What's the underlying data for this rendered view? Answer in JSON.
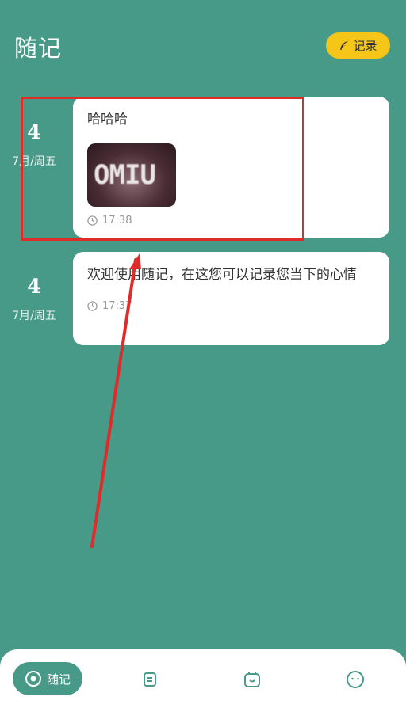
{
  "header": {
    "title": "随记",
    "record_button_label": "记录"
  },
  "entries": [
    {
      "day": "4",
      "month_week": "7月/周五",
      "text": "哈哈哈",
      "image_text": "OMIU",
      "time": "17:38"
    },
    {
      "day": "4",
      "month_week": "7月/周五",
      "text": "欢迎使用随记，在这您可以记录您当下的心情",
      "time": "17:37"
    }
  ],
  "bottom_nav": {
    "active_label": "随记",
    "items": [
      "notes-icon",
      "calendar-icon",
      "profile-icon"
    ]
  },
  "colors": {
    "background": "#489a88",
    "accent": "#f5c518",
    "annotation": "#e02b2b"
  }
}
